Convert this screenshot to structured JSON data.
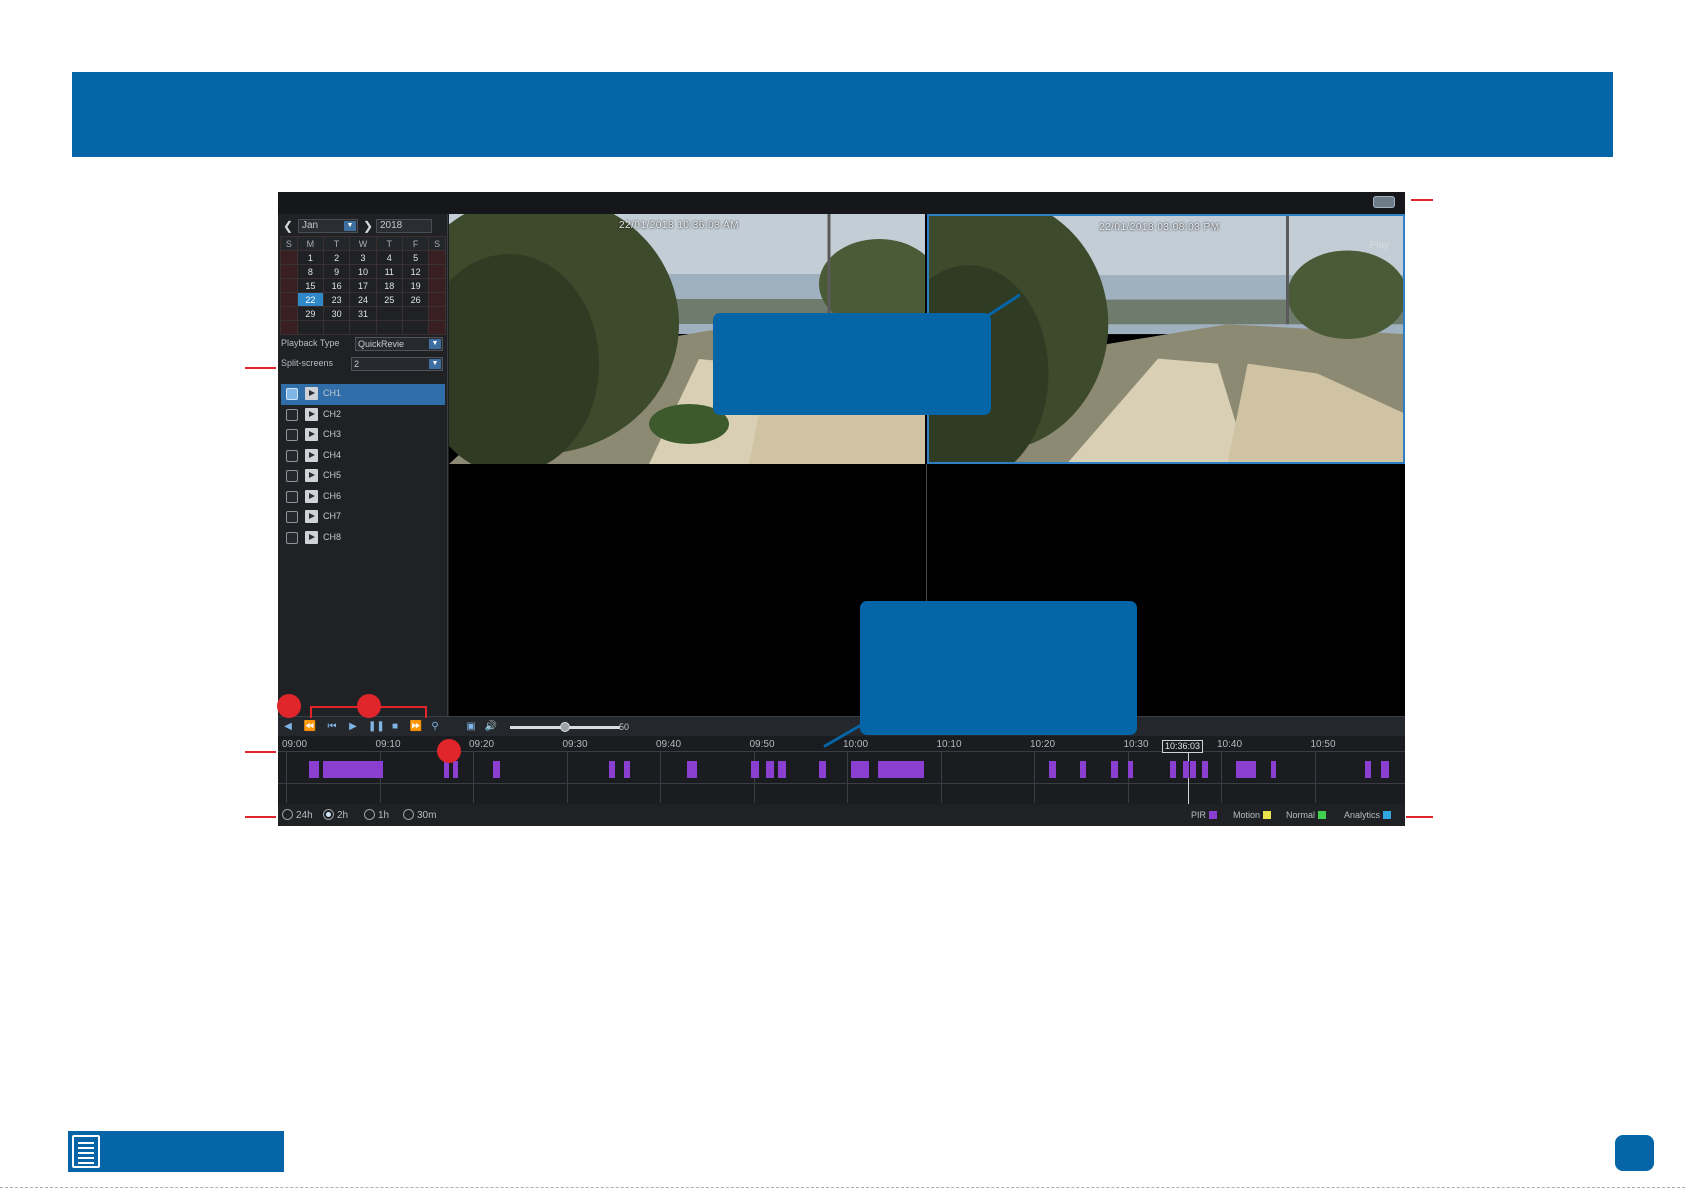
{
  "colors": {
    "brand_blue": "#0565a6",
    "annotation_red": "#e0252b",
    "pir": "#8a3fd1",
    "motion": "#e8e34a",
    "normal": "#3fd14d",
    "analytics": "#2fa6e0"
  },
  "calendar": {
    "month": "Jan",
    "year": "2018",
    "weekdays": [
      "S",
      "M",
      "T",
      "W",
      "T",
      "F",
      "S"
    ],
    "weeks": [
      [
        "",
        "1",
        "2",
        "3",
        "4",
        "5",
        ""
      ],
      [
        "",
        "8",
        "9",
        "10",
        "11",
        "12",
        ""
      ],
      [
        "",
        "15",
        "16",
        "17",
        "18",
        "19",
        ""
      ],
      [
        "",
        "22",
        "23",
        "24",
        "25",
        "26",
        ""
      ],
      [
        "",
        "29",
        "30",
        "31",
        "",
        "",
        ""
      ],
      [
        "",
        "",
        "",
        "",
        "",
        "",
        ""
      ]
    ]
  },
  "playback_type": {
    "label": "Playback Type",
    "value": "QuickRevie"
  },
  "split_screens": {
    "label": "Split-screens",
    "value": "2"
  },
  "channels": [
    "CH1",
    "CH2",
    "CH3",
    "CH4",
    "CH5",
    "CH6",
    "CH7",
    "CH8"
  ],
  "video": {
    "cam1_osd": "22/01/2018 10:36:03 AM",
    "cam2_osd": "22/01/2018 03:08:03 PM",
    "cam2_status": "Play"
  },
  "volume": "50",
  "timeline": {
    "ticks": [
      "09:00",
      "09:10",
      "09:20",
      "09:30",
      "09:40",
      "09:50",
      "10:00",
      "10:10",
      "10:20",
      "10:30",
      "10:40",
      "10:50"
    ],
    "cursor_time": "10:36:03"
  },
  "range_options": [
    {
      "label": "24h",
      "selected": false
    },
    {
      "label": "2h",
      "selected": true
    },
    {
      "label": "1h",
      "selected": false
    },
    {
      "label": "30m",
      "selected": false
    }
  ],
  "legend": [
    "PIR",
    "Motion",
    "Normal",
    "Analytics"
  ]
}
